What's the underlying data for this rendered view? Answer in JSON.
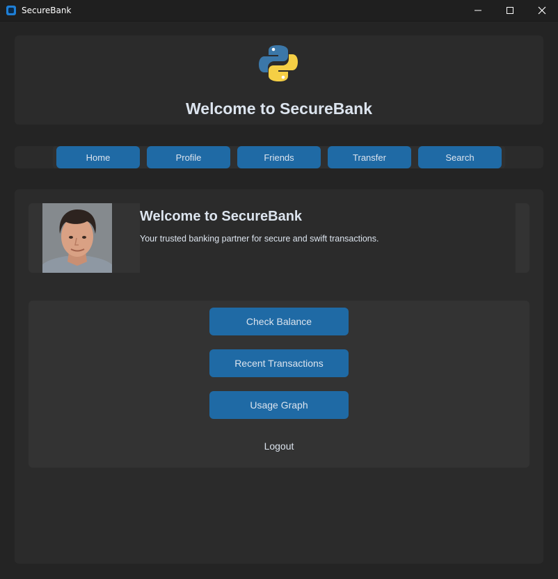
{
  "window": {
    "title": "SecureBank",
    "app_icon": "app-icon",
    "controls": [
      "minimize-icon",
      "maximize-icon",
      "close-icon"
    ]
  },
  "header": {
    "logo_icon": "python-logo",
    "title": "Welcome to SecureBank"
  },
  "nav": {
    "items": [
      {
        "label": "Home"
      },
      {
        "label": "Profile"
      },
      {
        "label": "Friends"
      },
      {
        "label": "Transfer"
      },
      {
        "label": "Search"
      }
    ]
  },
  "welcome_card": {
    "avatar": "user-avatar-photo",
    "title": "Welcome to SecureBank",
    "description": "Your trusted banking partner for secure and swift transactions."
  },
  "actions": {
    "check_balance": "Check Balance",
    "recent_transactions": "Recent Transactions",
    "usage_graph": "Usage Graph",
    "logout": "Logout"
  },
  "colors": {
    "background": "#242424",
    "panel": "#2b2b2b",
    "accent": "#1f6aa5",
    "text": "#dce4ee"
  }
}
